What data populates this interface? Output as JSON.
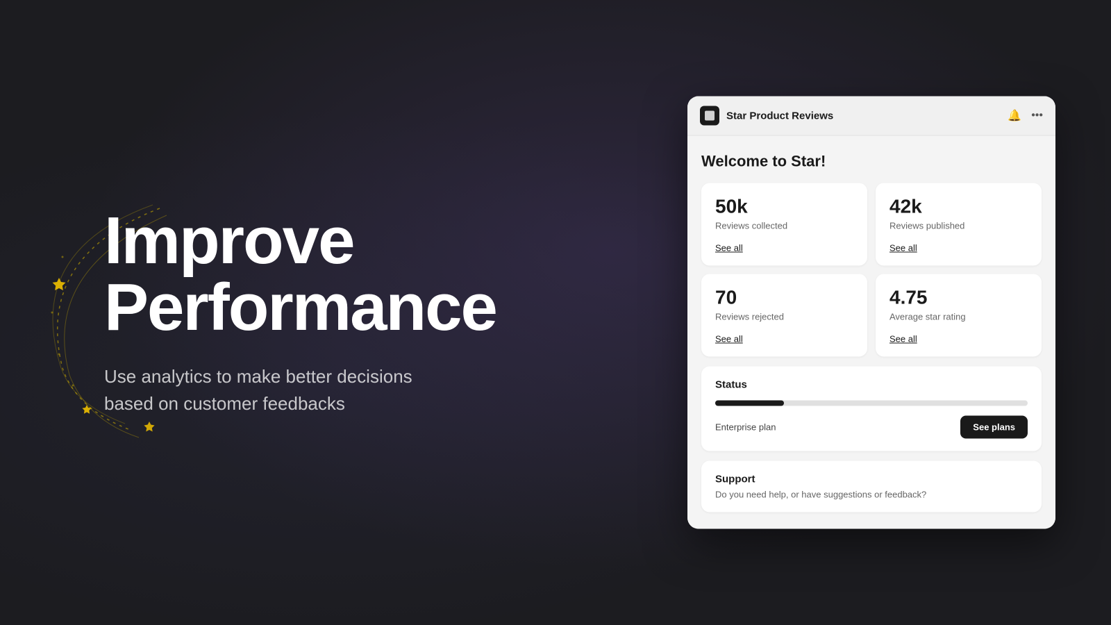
{
  "background": {
    "color": "#1c1c20"
  },
  "left": {
    "headline_line1": "Improve",
    "headline_line2": "Performance",
    "subtext": "Use analytics to make better decisions based on customer feedbacks"
  },
  "panel": {
    "app_name": "Star Product Reviews",
    "bell_icon": "🔔",
    "more_icon": "···",
    "welcome_title": "Welcome to Star!",
    "stats": [
      {
        "number": "50k",
        "label": "Reviews collected",
        "link": "See all"
      },
      {
        "number": "42k",
        "label": "Reviews published",
        "link": "See all"
      },
      {
        "number": "70",
        "label": "Reviews rejected",
        "link": "See all"
      },
      {
        "number": "4.75",
        "label": "Average star rating",
        "link": "See all"
      }
    ],
    "status": {
      "title": "Status",
      "progress_percent": 22,
      "plan_label": "Enterprise plan",
      "see_plans_label": "See plans"
    },
    "support": {
      "title": "Support",
      "text": "Do you need help, or have suggestions or feedback?"
    }
  }
}
